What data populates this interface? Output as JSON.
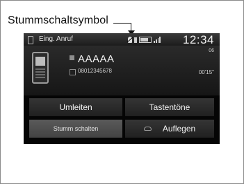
{
  "callout": {
    "label": "Stummschaltsymbol"
  },
  "statusbar": {
    "title": "Eing. Anruf",
    "clock": "12:34"
  },
  "call": {
    "contact_name": "AAAAA",
    "contact_number": "08012345678",
    "signal_label": "06",
    "duration": "00'15\""
  },
  "buttons": {
    "umleiten": "Umleiten",
    "tastentoene": "Tastentöne",
    "stumm": "Stumm schalten",
    "auflegen": "Auflegen"
  },
  "icons": {
    "status": [
      "phone-icon",
      "mute-icon",
      "battery-icon",
      "signal-icon"
    ],
    "contact": [
      "contact-icon",
      "number-icon"
    ],
    "hangup": "hangup-icon"
  }
}
